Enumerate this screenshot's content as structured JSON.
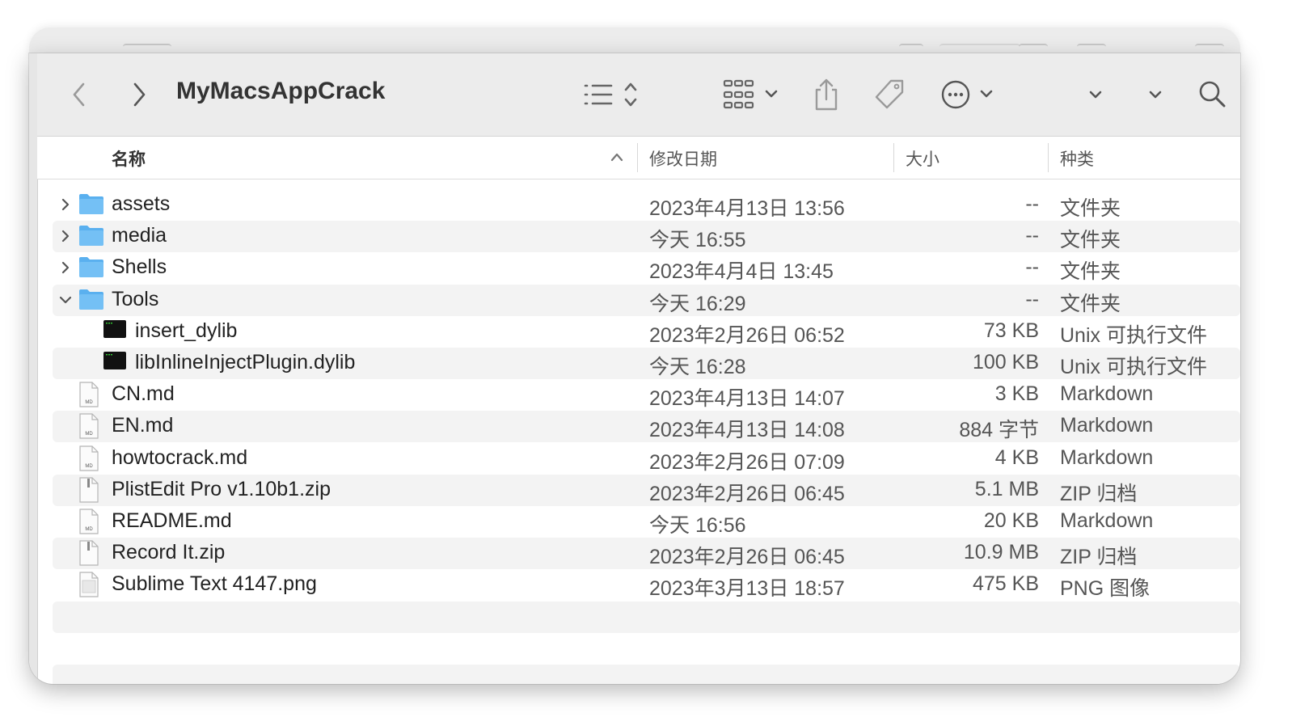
{
  "window": {
    "title": "MyMacsAppCrack"
  },
  "toolbar": {
    "back_icon": "chevron-left-icon",
    "forward_icon": "chevron-right-icon",
    "view_icon": "list-view-icon",
    "group_icon": "grid-group-icon",
    "share_icon": "share-icon",
    "tag_icon": "tag-icon",
    "more_icon": "ellipsis-circle-icon",
    "search_icon": "search-icon"
  },
  "columns": {
    "name": "名称",
    "date": "修改日期",
    "size": "大小",
    "kind": "种类"
  },
  "files": [
    {
      "name": "assets",
      "date": "2023年4月13日 13:56",
      "size": "--",
      "kind": "文件夹",
      "icon": "folder-icon",
      "disclosure": "collapsed",
      "indent": 0
    },
    {
      "name": "media",
      "date": "今天 16:55",
      "size": "--",
      "kind": "文件夹",
      "icon": "folder-icon",
      "disclosure": "collapsed",
      "indent": 0
    },
    {
      "name": "Shells",
      "date": "2023年4月4日 13:45",
      "size": "--",
      "kind": "文件夹",
      "icon": "folder-icon",
      "disclosure": "collapsed",
      "indent": 0
    },
    {
      "name": "Tools",
      "date": "今天 16:29",
      "size": "--",
      "kind": "文件夹",
      "icon": "folder-icon",
      "disclosure": "expanded",
      "indent": 0
    },
    {
      "name": "insert_dylib",
      "date": "2023年2月26日 06:52",
      "size": "73 KB",
      "kind": "Unix 可执行文件",
      "icon": "terminal-exec-icon",
      "disclosure": "none",
      "indent": 1
    },
    {
      "name": "libInlineInjectPlugin.dylib",
      "date": "今天 16:28",
      "size": "100 KB",
      "kind": "Unix 可执行文件",
      "icon": "terminal-exec-icon",
      "disclosure": "none",
      "indent": 1
    },
    {
      "name": "CN.md",
      "date": "2023年4月13日 14:07",
      "size": "3 KB",
      "kind": "Markdown",
      "icon": "markdown-file-icon",
      "disclosure": "none",
      "indent": 0
    },
    {
      "name": "EN.md",
      "date": "2023年4月13日 14:08",
      "size": "884 字节",
      "kind": "Markdown",
      "icon": "markdown-file-icon",
      "disclosure": "none",
      "indent": 0
    },
    {
      "name": "howtocrack.md",
      "date": "2023年2月26日 07:09",
      "size": "4 KB",
      "kind": "Markdown",
      "icon": "markdown-file-icon",
      "disclosure": "none",
      "indent": 0
    },
    {
      "name": "PlistEdit Pro v1.10b1.zip",
      "date": "2023年2月26日 06:45",
      "size": "5.1 MB",
      "kind": "ZIP 归档",
      "icon": "zip-file-icon",
      "disclosure": "none",
      "indent": 0
    },
    {
      "name": "README.md",
      "date": "今天 16:56",
      "size": "20 KB",
      "kind": "Markdown",
      "icon": "markdown-file-icon",
      "disclosure": "none",
      "indent": 0
    },
    {
      "name": "Record It.zip",
      "date": "2023年2月26日 06:45",
      "size": "10.9 MB",
      "kind": "ZIP 归档",
      "icon": "zip-file-icon",
      "disclosure": "none",
      "indent": 0
    },
    {
      "name": "Sublime Text 4147.png",
      "date": "2023年3月13日 18:57",
      "size": "475 KB",
      "kind": "PNG 图像",
      "icon": "image-file-icon",
      "disclosure": "none",
      "indent": 0
    }
  ],
  "colors": {
    "folder": "#5ab0ef",
    "toolbar_bg": "#ececec",
    "row_alt": "#f3f3f3"
  }
}
